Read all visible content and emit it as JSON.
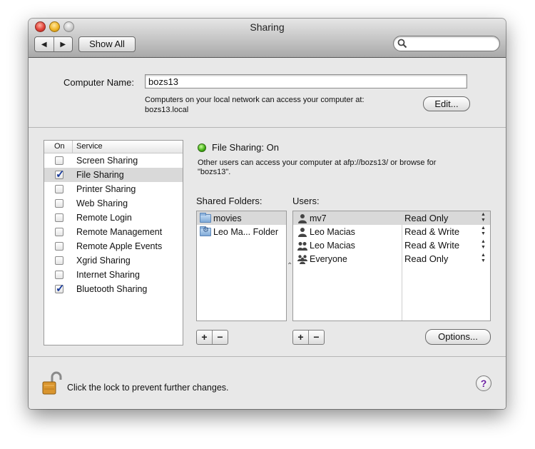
{
  "window": {
    "title": "Sharing"
  },
  "toolbar": {
    "back_label": "◀",
    "forward_label": "▶",
    "show_all_label": "Show All",
    "search_value": "",
    "search_placeholder": ""
  },
  "computer": {
    "label": "Computer Name:",
    "name": "bozs13",
    "desc_line1": "Computers on your local network can access your computer at:",
    "desc_line2": "bozs13.local",
    "edit_label": "Edit..."
  },
  "services": {
    "header_on": "On",
    "header_service": "Service",
    "items": [
      {
        "label": "Screen Sharing",
        "checked": false,
        "selected": false
      },
      {
        "label": "File Sharing",
        "checked": true,
        "selected": true
      },
      {
        "label": "Printer Sharing",
        "checked": false,
        "selected": false
      },
      {
        "label": "Web Sharing",
        "checked": false,
        "selected": false
      },
      {
        "label": "Remote Login",
        "checked": false,
        "selected": false
      },
      {
        "label": "Remote Management",
        "checked": false,
        "selected": false
      },
      {
        "label": "Remote Apple Events",
        "checked": false,
        "selected": false
      },
      {
        "label": "Xgrid Sharing",
        "checked": false,
        "selected": false
      },
      {
        "label": "Internet Sharing",
        "checked": false,
        "selected": false
      },
      {
        "label": "Bluetooth Sharing",
        "checked": true,
        "selected": false
      }
    ]
  },
  "status": {
    "text": "File Sharing: On",
    "color": "#3fae12",
    "desc_line1": "Other users can access your computer at afp://bozs13/ or browse for",
    "desc_line2": "\"bozs13\"."
  },
  "shared_folders": {
    "label": "Shared Folders:",
    "items": [
      {
        "name": "movies",
        "icon": "folder-icon",
        "selected": true
      },
      {
        "name": "Leo Ma... Folder",
        "icon": "shared-folder-icon",
        "selected": false
      }
    ],
    "add_label": "+",
    "remove_label": "−"
  },
  "users": {
    "label": "Users:",
    "items": [
      {
        "name": "mv7",
        "icon": "user-icon",
        "permission": "Read Only",
        "selected": true
      },
      {
        "name": "Leo Macias",
        "icon": "user-icon",
        "permission": "Read & Write",
        "selected": false
      },
      {
        "name": "Leo Macias",
        "icon": "group-icon",
        "permission": "Read & Write",
        "selected": false
      },
      {
        "name": "Everyone",
        "icon": "everyone-icon",
        "permission": "Read Only",
        "selected": false
      }
    ],
    "add_label": "+",
    "remove_label": "−",
    "options_label": "Options..."
  },
  "footer": {
    "lock_text": "Click the lock to prevent further changes.",
    "help_label": "?"
  }
}
